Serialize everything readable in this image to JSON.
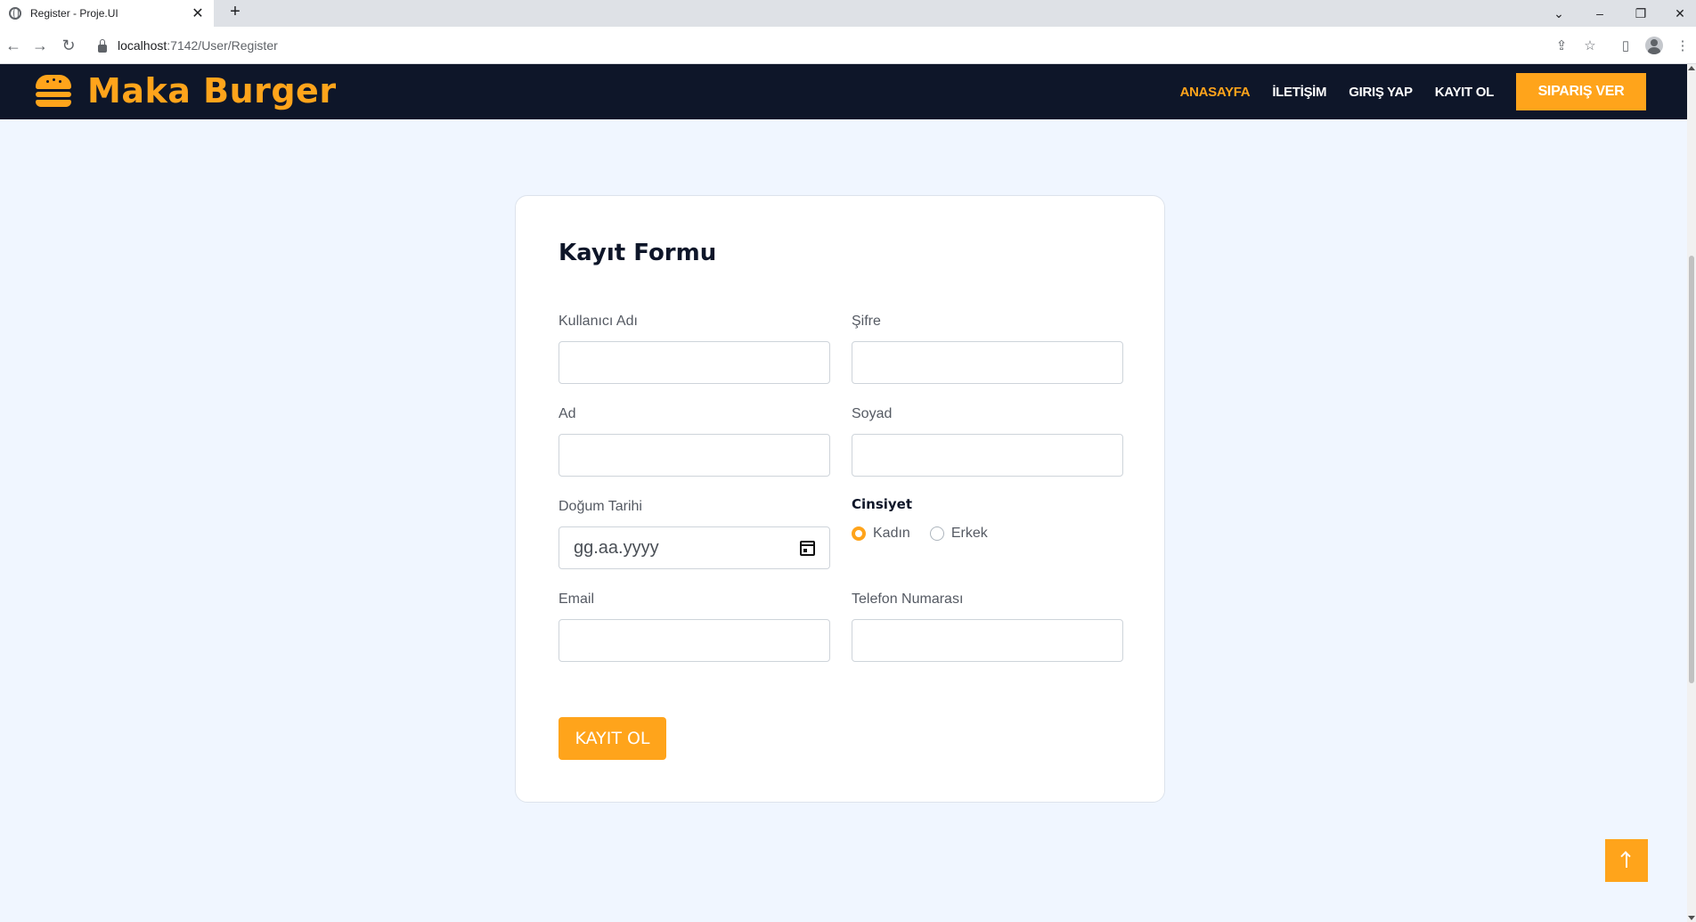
{
  "browser": {
    "tab_title": "Register - Proje.UI",
    "tab_close": "✕",
    "new_tab": "+",
    "url_host": "localhost",
    "url_path": ":7142/User/Register",
    "window_controls": {
      "dropdown": "⌄",
      "minimize": "–",
      "restore": "❐",
      "close": "✕"
    },
    "nav": {
      "back": "←",
      "forward": "→",
      "reload": "↻"
    },
    "right_icons": {
      "share": "⇪",
      "star": "☆",
      "sidebar": "▯",
      "menu": "⋮"
    }
  },
  "header": {
    "brand": "Maka Burger",
    "nav_items": [
      {
        "label": "ANASAYFA",
        "active": true
      },
      {
        "label": "İLETİŞİM",
        "active": false
      },
      {
        "label": "GIRIŞ YAP",
        "active": false
      },
      {
        "label": "KAYIT OL",
        "active": false
      }
    ],
    "order_button": "SIPARIŞ VER",
    "accent_color": "#ffa41b",
    "background_color": "#0e1629"
  },
  "form": {
    "title": "Kayıt Formu",
    "fields": {
      "username": {
        "label": "Kullanıcı Adı",
        "value": ""
      },
      "password": {
        "label": "Şifre",
        "value": ""
      },
      "first_name": {
        "label": "Ad",
        "value": ""
      },
      "last_name": {
        "label": "Soyad",
        "value": ""
      },
      "birth_date": {
        "label": "Doğum Tarihi",
        "placeholder": "gg.aa.yyyy"
      },
      "email": {
        "label": "Email",
        "value": ""
      },
      "phone": {
        "label": "Telefon Numarası",
        "value": ""
      }
    },
    "gender": {
      "label": "Cinsiyet",
      "options": [
        {
          "label": "Kadın",
          "checked": true
        },
        {
          "label": "Erkek",
          "checked": false
        }
      ]
    },
    "submit_label": "KAYIT OL"
  },
  "scroll_top_icon": "arrow-up-icon"
}
